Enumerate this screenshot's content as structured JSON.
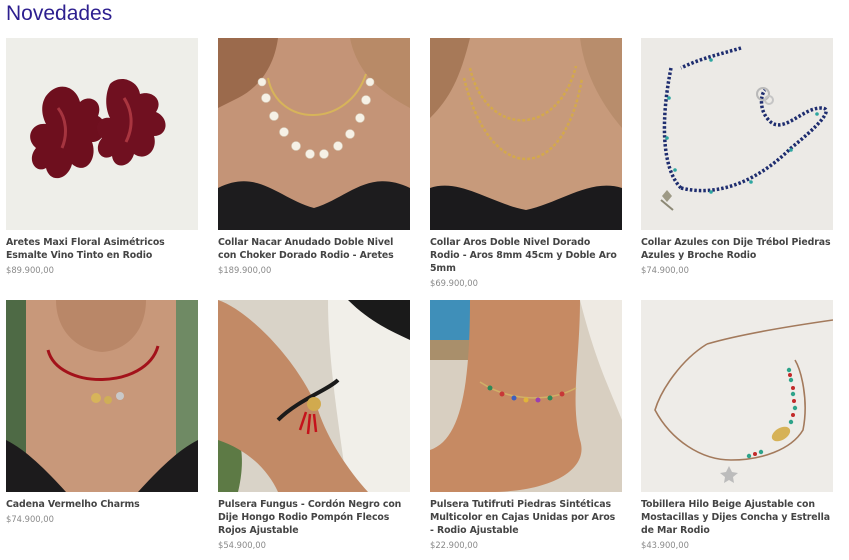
{
  "section_title": "Novedades",
  "products": [
    {
      "name": "Aretes Maxi Floral Asimétricos Esmalte Vino Tinto en Rodio",
      "price": "$89.900,00",
      "icon": "earrings-image"
    },
    {
      "name": "Collar Nacar Anudado Doble Nivel con Choker Dorado Rodio - Aretes",
      "price": "$189.900,00",
      "icon": "pearl-necklace-image"
    },
    {
      "name": "Collar Aros Doble Nivel Dorado Rodio - Aros 8mm 45cm y Doble Aro 5mm",
      "price": "$69.900,00",
      "icon": "gold-chain-image"
    },
    {
      "name": "Collar Azules con Dije Trébol Piedras Azules y Broche Rodio",
      "price": "$74.900,00",
      "icon": "blue-bead-necklace-image"
    },
    {
      "name": "Cadena Vermelho Charms",
      "price": "$74.900,00",
      "icon": "red-choker-image"
    },
    {
      "name": "Pulsera Fungus - Cordón Negro con Dije Hongo Rodio Pompón Flecos Rojos Ajustable",
      "price": "$54.900,00",
      "icon": "bracelet-image"
    },
    {
      "name": "Pulsera Tutifruti Piedras Sintéticas Multicolor en Cajas Unidas por Aros - Rodio Ajustable",
      "price": "$22.900,00",
      "icon": "anklet-image"
    },
    {
      "name": "Tobillera Hilo Beige Ajustable con Mostacillas y Dijes Concha y Estrella de Mar Rodio",
      "price": "$43.900,00",
      "icon": "beaded-anklet-image"
    }
  ],
  "colors": {
    "title": "#2d1f8f",
    "name": "#444444",
    "price": "#8a8a8a"
  }
}
